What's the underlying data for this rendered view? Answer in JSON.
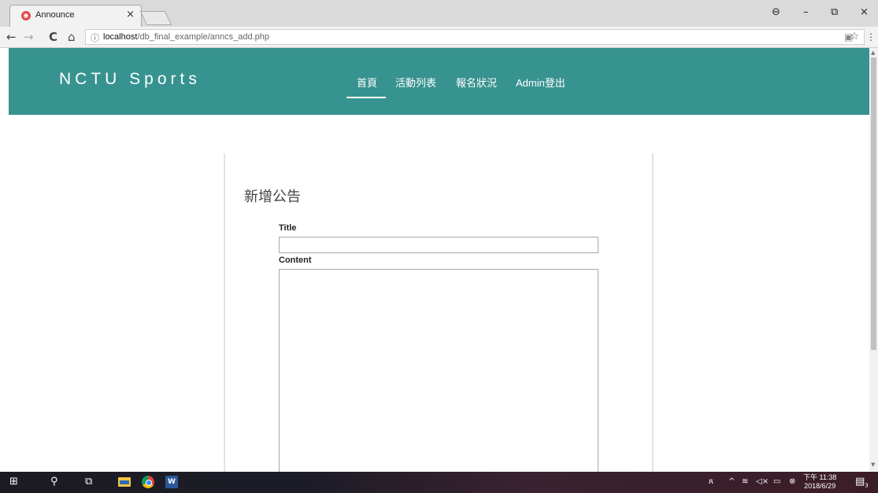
{
  "browser": {
    "tab_title": "Announce",
    "tab_close": "×",
    "url_host": "localhost",
    "url_path": "/db_final_example/anncs_add.php",
    "win_controls": {
      "account": "⊖",
      "minimize": "–",
      "restore": "⧉",
      "close": "×"
    },
    "nav": {
      "back": "←",
      "forward": "→",
      "reload": "C",
      "home": "⌂"
    },
    "info_icon": "ⓘ",
    "star": "☆",
    "menu": "⋮"
  },
  "site": {
    "brand": "NCTU Sports",
    "nav": [
      "首頁",
      "活動列表",
      "報名狀況",
      "Admin登出"
    ],
    "active_nav": "首頁"
  },
  "form": {
    "heading": "新增公告",
    "title_label": "Title",
    "title_value": "",
    "content_label": "Content",
    "content_value": ""
  },
  "taskbar": {
    "time": "下午 11:38",
    "date": "2018/6/29",
    "notification_count": "3"
  },
  "colors": {
    "header_bg": "#379390",
    "taskbar_bg": "#1c1b24"
  }
}
